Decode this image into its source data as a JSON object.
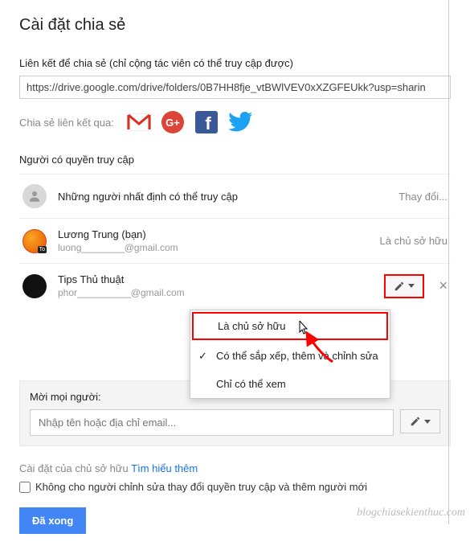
{
  "title": "Cài đặt chia sẻ",
  "link": {
    "label": "Liên kết để chia sẻ (chỉ cộng tác viên có thể truy cập được)",
    "value": "https://drive.google.com/drive/folders/0B7HH8fje_vtBWlVEV0xXZGFEUkk?usp=sharin"
  },
  "shareVia": {
    "label": "Chia sẻ liên kết qua:"
  },
  "access": {
    "heading": "Người có quyền truy cập",
    "specific": {
      "text": "Những người nhất định có thể truy cập",
      "action": "Thay đổi..."
    },
    "owner": {
      "name": "Lương Trung (bạn)",
      "email": "luong________@gmail.com",
      "role": "Là chủ sở hữu"
    },
    "user2": {
      "name": "Tips Thủ thuật",
      "email": "phor__________@gmail.com"
    }
  },
  "dropdown": {
    "owner": "Là chủ sở hữu",
    "edit": "Có thể sắp xếp, thêm và chỉnh sửa",
    "view": "Chỉ có thể xem"
  },
  "invite": {
    "label": "Mời mọi người:",
    "placeholder": "Nhập tên hoặc địa chỉ email..."
  },
  "ownerSettings": {
    "label": "Cài đặt của chủ sở hữu",
    "learnMore": "Tìm hiểu thêm",
    "checkbox": "Không cho người chỉnh sửa thay đổi quyền truy cập và thêm người mới"
  },
  "doneBtn": "Đã xong",
  "watermark": "blogchiasekienthuc.com"
}
